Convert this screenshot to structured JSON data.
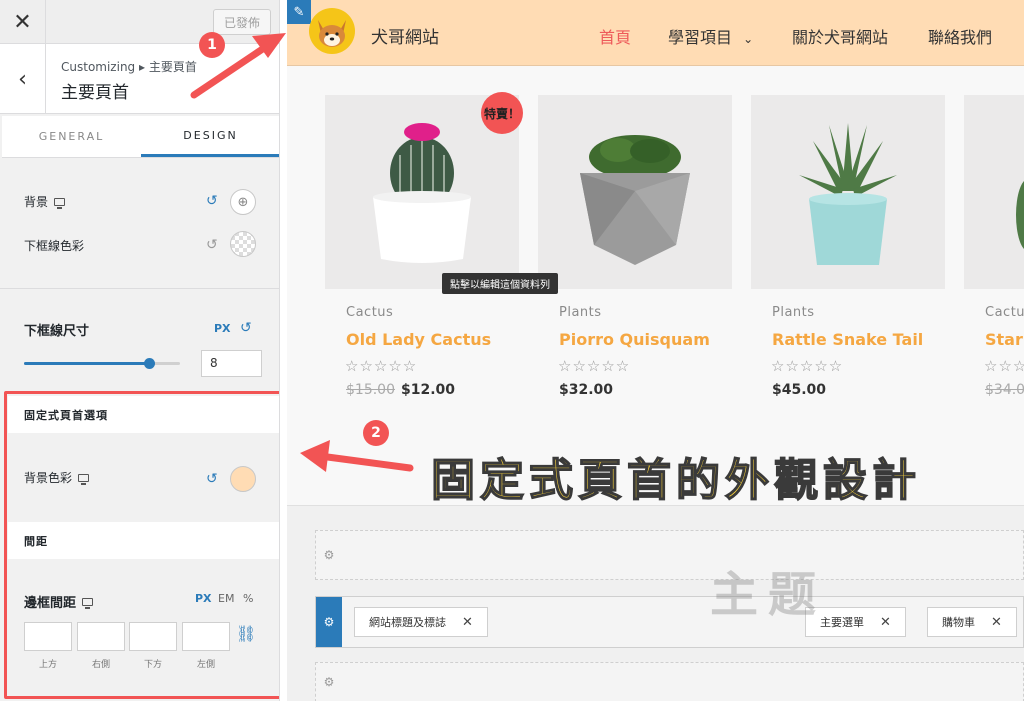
{
  "panel": {
    "close_icon": "close-icon",
    "publish_label": "已發佈",
    "breadcrumb": "Customizing ▸ 主要頁首",
    "section_title": "主要頁首",
    "tabs": [
      {
        "label": "GENERAL",
        "active": false
      },
      {
        "label": "DESIGN",
        "active": true
      }
    ],
    "background_label": "背景",
    "border_color_label": "下框線色彩",
    "border_size_label": "下框線尺寸",
    "border_size_unit": "PX",
    "border_size_value": "8",
    "border_size_fraction": 0.8,
    "sticky_header_title": "固定式頁首選項",
    "bg_color_label": "背景色彩",
    "sticky_bg_color": "#ffdcb4",
    "spacing_title": "間距",
    "padding_label": "邊框間距",
    "padding_units": [
      "PX",
      "EM",
      "%"
    ],
    "padding_sides": [
      "上方",
      "右側",
      "下方",
      "左側"
    ]
  },
  "site": {
    "title": "犬哥網站",
    "header_color": "#ffdcb4",
    "nav": [
      {
        "label": "首頁",
        "active": true
      },
      {
        "label": "學習項目",
        "dropdown": true
      },
      {
        "label": "關於犬哥網站"
      },
      {
        "label": "聯絡我們"
      }
    ]
  },
  "products": [
    {
      "category": "Cactus",
      "name": "Old Lady Cactus",
      "old_price": "$15.00",
      "price": "$12.00",
      "sale_badge": "特賣！",
      "rating": "☆☆☆☆☆"
    },
    {
      "category": "Plants",
      "name": "Piorro Quisquam",
      "price": "$32.00",
      "rating": "☆☆☆☆☆"
    },
    {
      "category": "Plants",
      "name": "Rattle Snake Tail",
      "price": "$45.00",
      "rating": "☆☆☆☆☆"
    },
    {
      "category": "Cactu",
      "name": "Star",
      "old_price": "$34.0",
      "rating": "☆☆☆☆☆"
    }
  ],
  "tooltip": "點擊以編輯這個資料列",
  "caption": "固定式頁首的外觀設計",
  "builder": {
    "chips": [
      "網站標題及標誌",
      "主要選單",
      "購物車"
    ]
  },
  "watermark": "主题",
  "annotations": {
    "step1": "1",
    "step2": "2"
  }
}
